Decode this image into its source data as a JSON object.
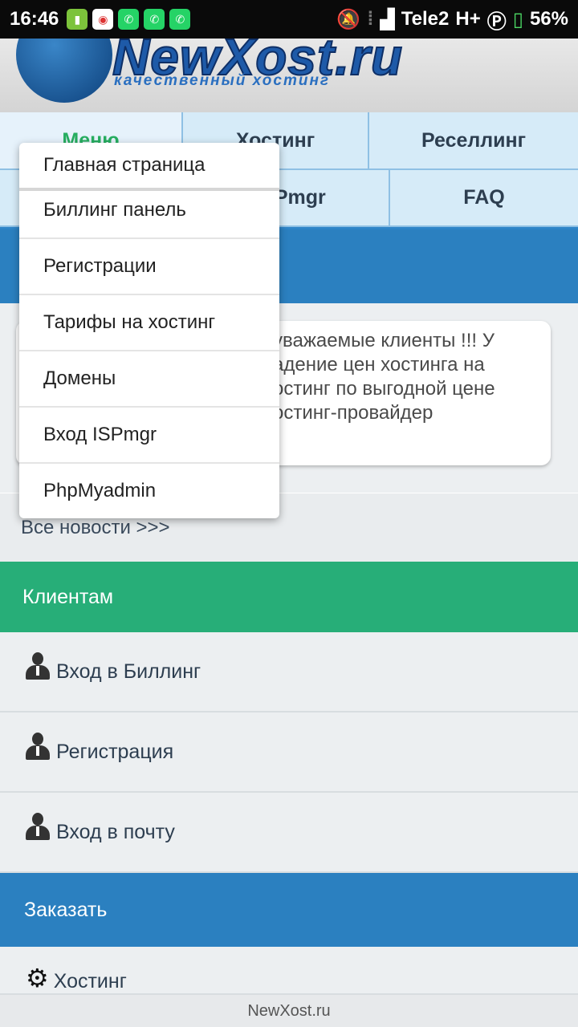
{
  "status_bar": {
    "time": "16:46",
    "carrier": "Tele2",
    "network": "H+",
    "battery": "56%",
    "icons": [
      "battery-app-icon",
      "chrome-icon",
      "whatsapp-icon",
      "whatsapp-icon",
      "whatsapp-icon",
      "mute-icon",
      "signal-icon"
    ]
  },
  "header": {
    "logo_text": "NewXost.ru",
    "logo_subtitle": "качественный хостинг"
  },
  "nav": {
    "items": [
      "Меню",
      "Хостинг",
      "Реселлинг",
      "ISPmgr",
      "FAQ"
    ]
  },
  "news": {
    "card_lines": [
      "уважаемые клиенты !!! У",
      "адение цен хостинга на",
      "остинг по выгодной цене",
      "остинг-провайдер"
    ],
    "all_news": "Все новости >>>"
  },
  "clients": {
    "title": "Клиентам",
    "items": [
      "Вход в Биллинг",
      "Регистрация",
      "Вход в почту"
    ]
  },
  "order": {
    "title": "Заказать",
    "items": [
      "Хостинг"
    ]
  },
  "footer": {
    "text": "NewXost.ru"
  },
  "dropdown": {
    "items": [
      "Главная страница",
      "Биллинг панель",
      "Регистрации",
      "Тарифы на хостинг",
      "Домены",
      "Вход ISPmgr",
      "PhpMyadmin"
    ]
  },
  "colors": {
    "blue_band": "#2b80c0",
    "green_band": "#27ae78",
    "active_nav": "#27ae60"
  }
}
